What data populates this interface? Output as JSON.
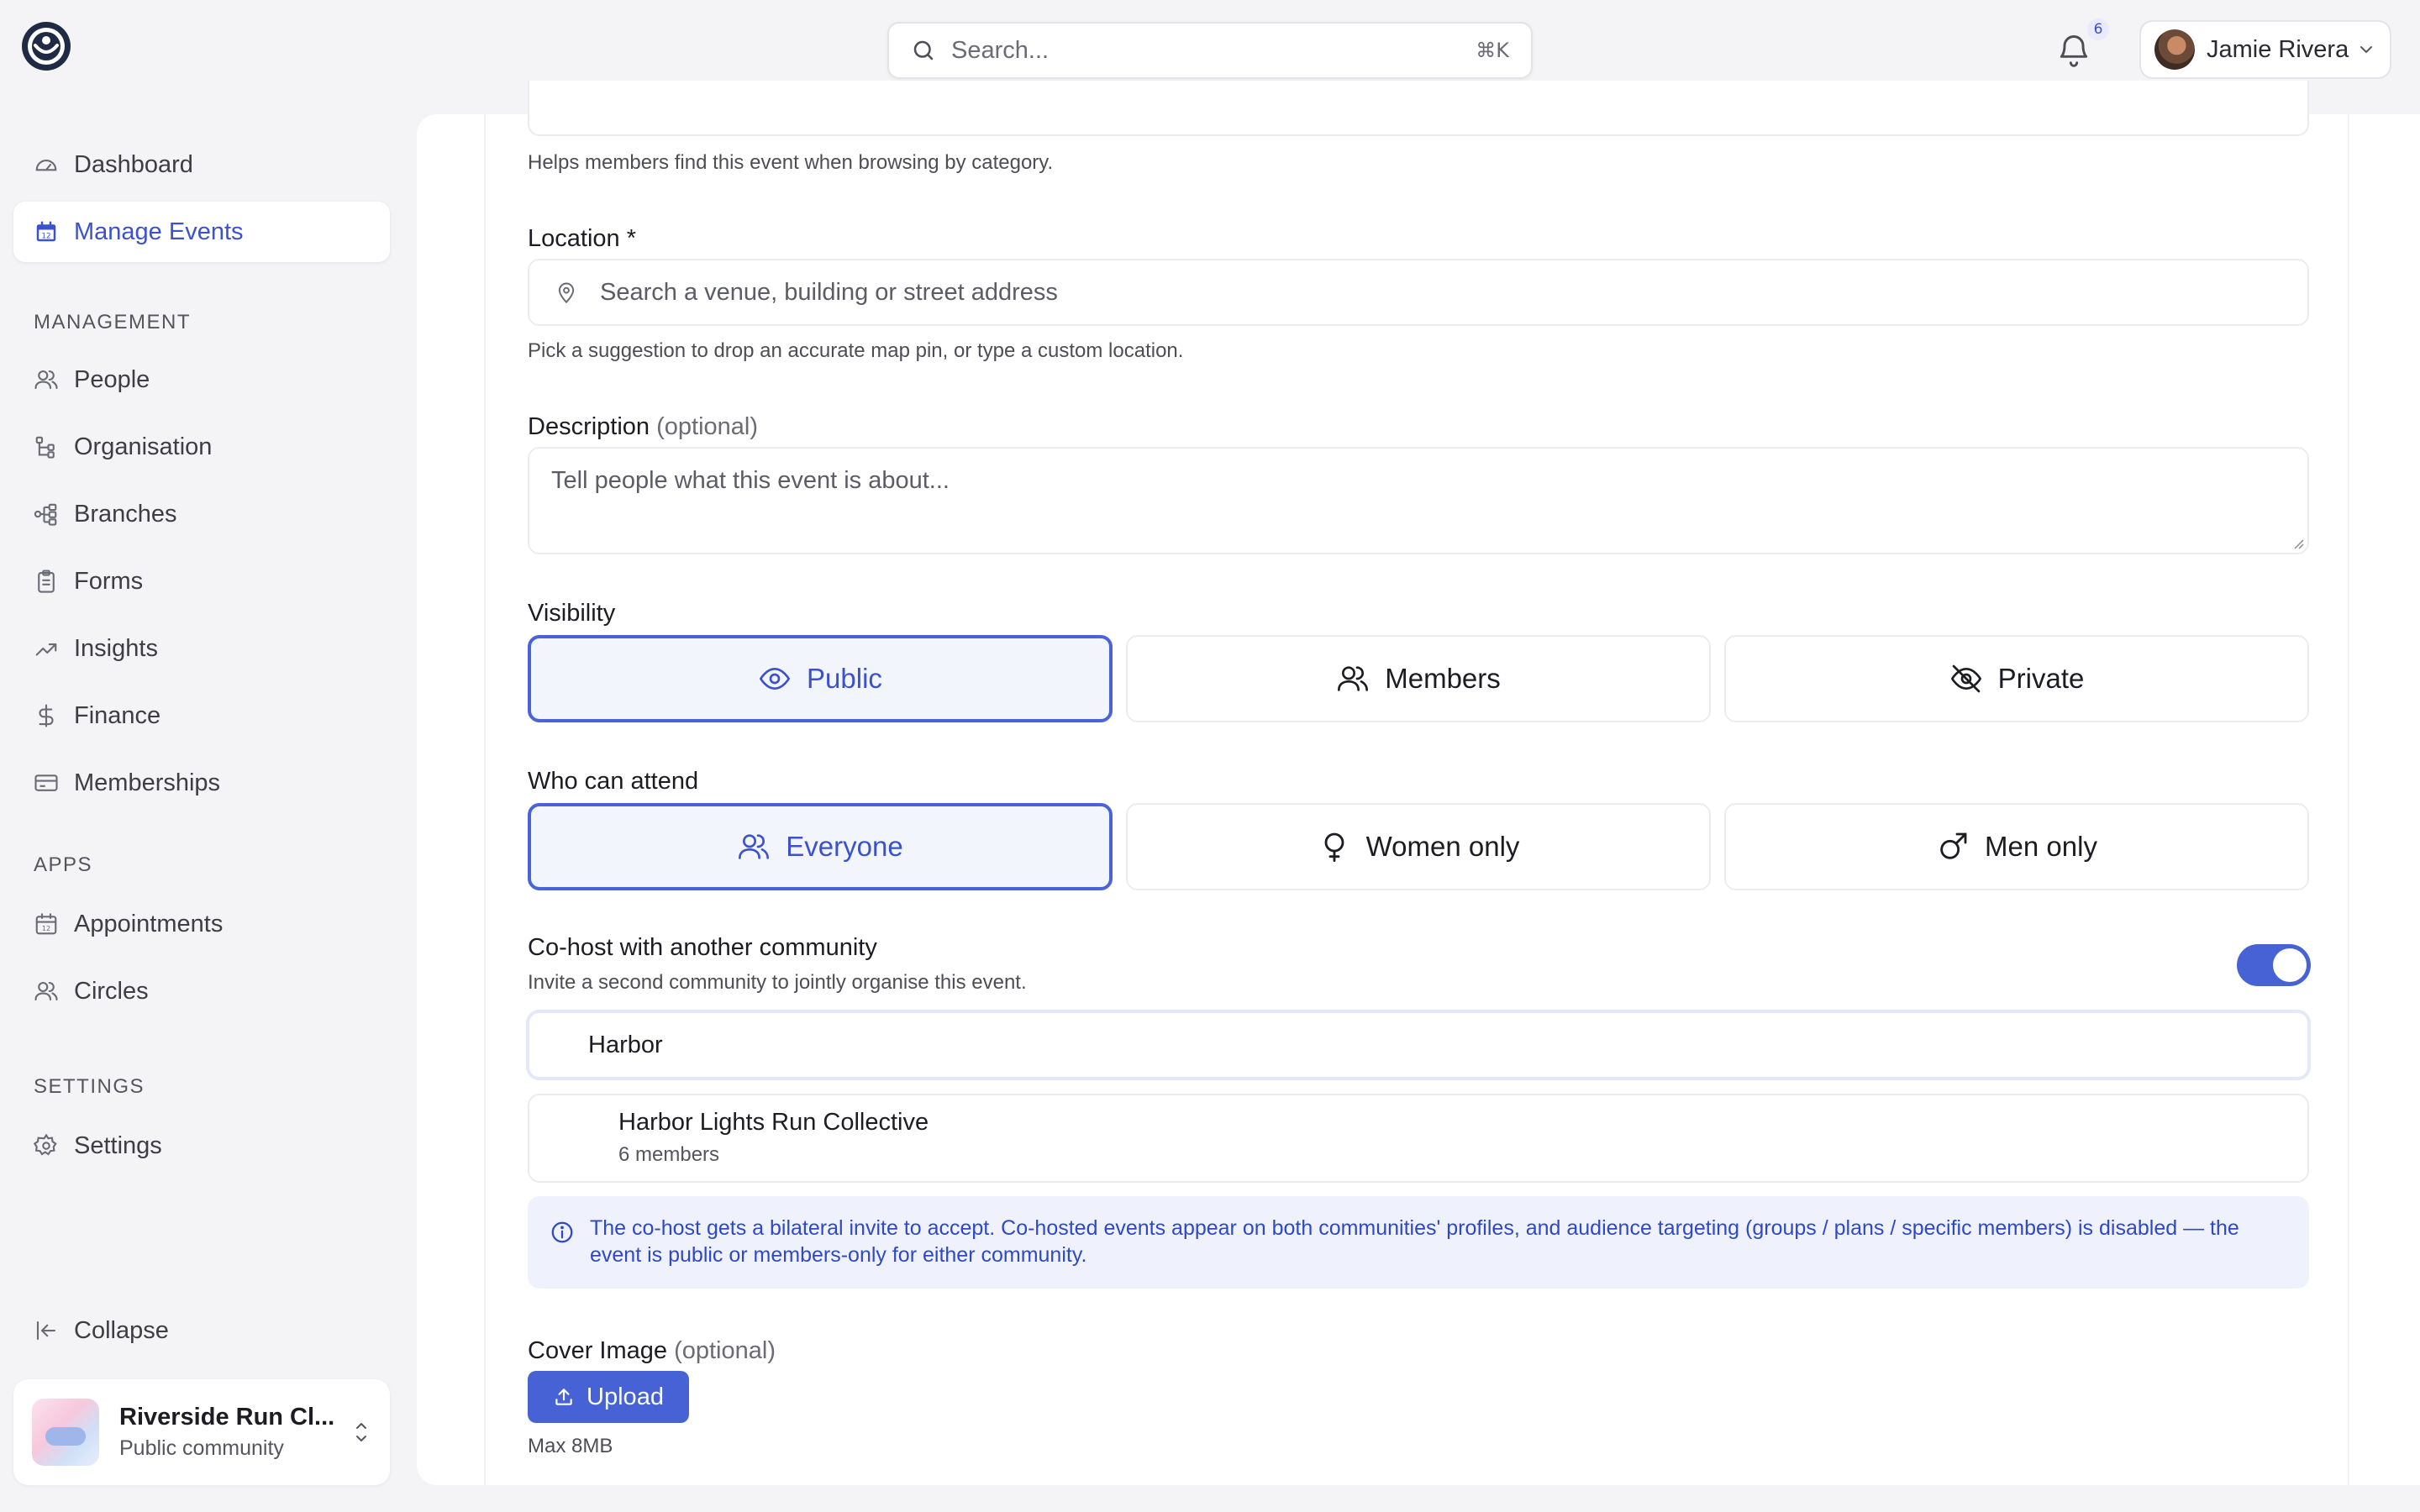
{
  "topbar": {
    "search_placeholder": "Search...",
    "search_shortcut": "⌘K",
    "notifications_count": "6",
    "user_name": "Jamie Rivera"
  },
  "sidebar": {
    "primary": [
      {
        "label": "Dashboard",
        "icon": "gauge-icon"
      },
      {
        "label": "Manage Events",
        "icon": "calendar-icon",
        "active": true
      }
    ],
    "management_label": "MANAGEMENT",
    "management": [
      {
        "label": "People",
        "icon": "users-icon"
      },
      {
        "label": "Organisation",
        "icon": "hierarchy-icon"
      },
      {
        "label": "Branches",
        "icon": "branches-icon"
      },
      {
        "label": "Forms",
        "icon": "clipboard-icon"
      },
      {
        "label": "Insights",
        "icon": "trending-icon"
      },
      {
        "label": "Finance",
        "icon": "dollar-icon"
      },
      {
        "label": "Memberships",
        "icon": "card-icon"
      }
    ],
    "apps_label": "APPS",
    "apps": [
      {
        "label": "Appointments",
        "icon": "calendar-icon"
      },
      {
        "label": "Circles",
        "icon": "users-icon"
      }
    ],
    "settings_label": "SETTINGS",
    "settings": [
      {
        "label": "Settings",
        "icon": "gear-icon"
      }
    ],
    "collapse_label": "Collapse",
    "community": {
      "name": "Riverside Run Cl...",
      "type": "Public community"
    }
  },
  "form": {
    "category_help": "Helps members find this event when browsing by category.",
    "location": {
      "label": "Location *",
      "placeholder": "Search a venue, building or street address",
      "help": "Pick a suggestion to drop an accurate map pin, or type a custom location."
    },
    "description": {
      "label": "Description",
      "optional": "(optional)",
      "placeholder": "Tell people what this event is about..."
    },
    "visibility": {
      "label": "Visibility",
      "options": [
        "Public",
        "Members",
        "Private"
      ],
      "selected": "Public"
    },
    "attendance": {
      "label": "Who can attend",
      "options": [
        "Everyone",
        "Women only",
        "Men only"
      ],
      "selected": "Everyone"
    },
    "cohost": {
      "label": "Co-host with another community",
      "help": "Invite a second community to jointly organise this event.",
      "enabled": true,
      "query": "Harbor",
      "suggestion_name": "Harbor Lights Run Collective",
      "suggestion_members": "6 members",
      "info": "The co-host gets a bilateral invite to accept. Co-hosted events appear on both communities' profiles, and audience targeting (groups / plans / specific members) is disabled — the event is public or members-only for either community."
    },
    "cover": {
      "label": "Cover Image",
      "optional": "(optional)",
      "upload_label": "Upload",
      "max_size": "Max 8MB"
    }
  },
  "colors": {
    "accent": "#4662d5",
    "accent_text": "#3b52cc",
    "info_bg": "#eff2fc"
  }
}
